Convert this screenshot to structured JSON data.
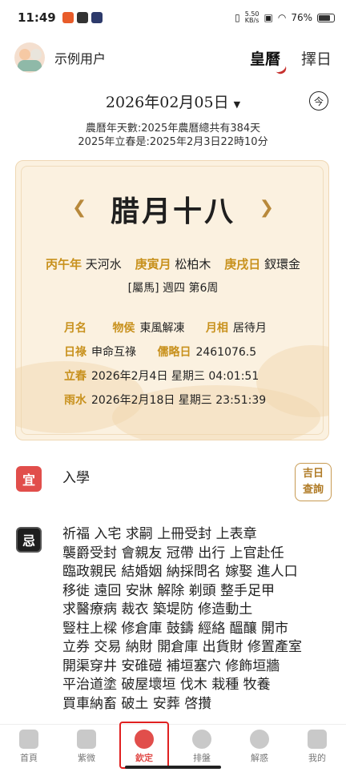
{
  "status": {
    "time": "11:49",
    "speed_top": "5.50",
    "speed_bottom": "KB/s",
    "battery": "76%"
  },
  "user": {
    "name": "示例用户"
  },
  "header_tabs": [
    {
      "label": "皇曆"
    },
    {
      "label": "擇日"
    }
  ],
  "date": {
    "gregorian": "2026年02月05日",
    "today_label": "今"
  },
  "info": {
    "line1": "農曆年天數:2025年農曆總共有384天",
    "line2": "2025年立春是:2025年2月3日22時10分"
  },
  "card": {
    "lunar_day": "腊月十八",
    "ganzhi": [
      {
        "label": "丙午年",
        "value": "天河水"
      },
      {
        "label": "庚寅月",
        "value": "松柏木"
      },
      {
        "label": "庚戌日",
        "value": "釵環金"
      }
    ],
    "week_line": "[屬馬] 週四 第6周",
    "details": {
      "yueming_label": "月名",
      "wuhou_label": "物侯",
      "wuhou_value": "東風解凍",
      "yuexiang_label": "月相",
      "yuexiang_value": "居待月",
      "rilu_label": "日祿",
      "rilu_value": "申命互祿",
      "julian_label": "儒略日",
      "julian_value": "2461076.5",
      "lichun_label": "立春",
      "lichun_value": "2026年2月4日 星期三 04:01:51",
      "yushui_label": "雨水",
      "yushui_value": "2026年2月18日 星期三 23:51:39"
    }
  },
  "yi": {
    "badge": "宜",
    "text": "入學",
    "button_line1": "吉日",
    "button_line2": "查詢"
  },
  "ji": {
    "badge": "忌",
    "lines": [
      "祈福 入宅 求嗣 上冊受封 上表章",
      "襲爵受封 會親友 冠帶 出行 上官赴任",
      "臨政親民 結婚姻 納採問名 嫁娶 進人口",
      "移徙 遠回 安牀 解除 剃頭 整手足甲",
      "求醫療病 裁衣 築堤防 修造動土",
      "豎柱上樑 修倉庫 鼓鑄 經絡 醞釀 開市",
      "立券 交易 納財 開倉庫 出貨財 修置產室",
      "開渠穿井 安碓磑 補垣塞穴 修飾垣牆",
      "平治道塗 破屋壞垣 伐木 栽種 牧養",
      "買車納畜 破土 安葬 啓攢"
    ]
  },
  "nav": [
    {
      "label": "首頁"
    },
    {
      "label": "紫微"
    },
    {
      "label": "欽定"
    },
    {
      "label": "排盤"
    },
    {
      "label": "解惑"
    },
    {
      "label": "我的"
    }
  ],
  "colors": {
    "accent_red": "#e14e4b",
    "gold": "#c8911d",
    "card_bg": "#fbf1e0"
  }
}
